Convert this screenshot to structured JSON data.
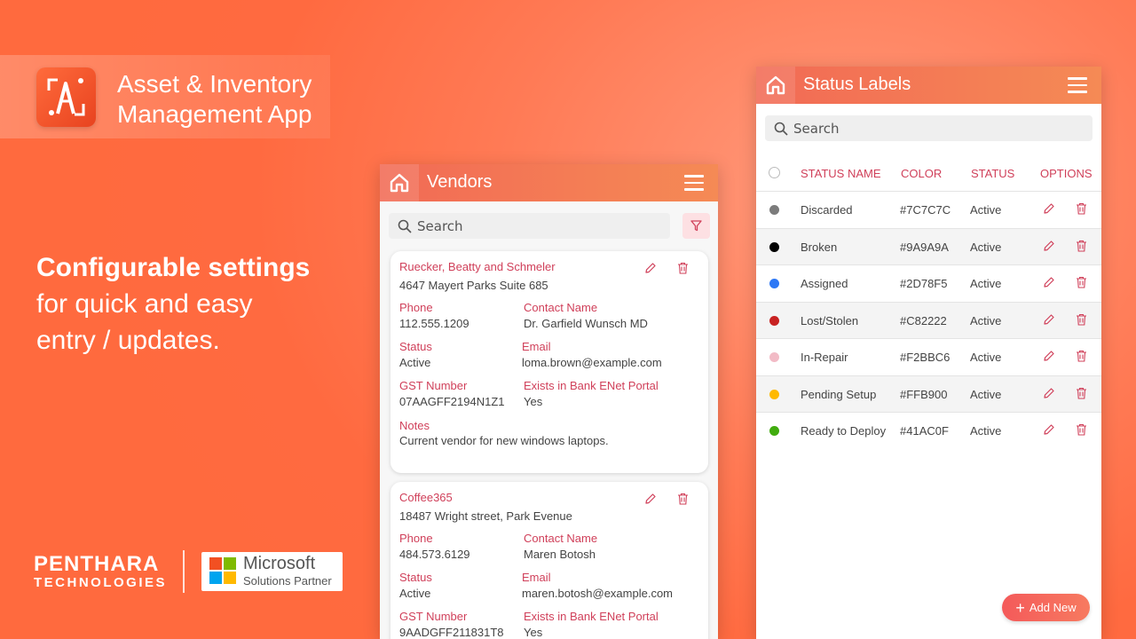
{
  "branding": {
    "app_title_line1": "Asset & Inventory",
    "app_title_line2": "Management App",
    "headline_bold": "Configurable settings",
    "headline_line2": "for quick and easy",
    "headline_line3": "entry / updates.",
    "company_line1": "PENTHARA",
    "company_line2": "TECHNOLOGIES",
    "partner_line1": "Microsoft",
    "partner_line2": "Solutions Partner"
  },
  "colors": {
    "accent": "#f26a55",
    "label": "#d0405a"
  },
  "vendors_panel": {
    "title": "Vendors",
    "search_placeholder": "Search",
    "cards": [
      {
        "name": "Ruecker, Beatty and Schmeler",
        "address": "4647 Mayert Parks Suite 685",
        "phone_label": "Phone",
        "phone": "112.555.1209",
        "contact_label": "Contact Name",
        "contact": "Dr. Garfield Wunsch MD",
        "status_label": "Status",
        "status": "Active",
        "email_label": "Email",
        "email": "loma.brown@example.com",
        "gst_label": "GST Number",
        "gst": "07AAGFF2194N1Z1",
        "portal_label": "Exists in Bank ENet Portal",
        "portal": "Yes",
        "notes_label": "Notes",
        "notes": "Current vendor for new windows laptops."
      },
      {
        "name": "Coffee365",
        "address": "18487 Wright street, Park Evenue",
        "phone_label": "Phone",
        "phone": "484.573.6129",
        "contact_label": "Contact Name",
        "contact": "Maren Botosh",
        "status_label": "Status",
        "status": "Active",
        "email_label": "Email",
        "email": "maren.botosh@example.com",
        "gst_label": "GST Number",
        "gst": "9AADGFF211831T8",
        "portal_label": "Exists in Bank ENet Portal",
        "portal": "Yes"
      }
    ]
  },
  "status_panel": {
    "title": "Status Labels",
    "search_placeholder": "Search",
    "columns": [
      "STATUS NAME",
      "COLOR",
      "STATUS",
      "OPTIONS"
    ],
    "rows": [
      {
        "name": "Discarded",
        "color": "#7C7C7C",
        "status": "Active"
      },
      {
        "name": "Broken",
        "color": "#9A9A9A",
        "status": "Active"
      },
      {
        "name": "Assigned",
        "color": "#2D78F5",
        "status": "Active"
      },
      {
        "name": "Lost/Stolen",
        "color": "#C82222",
        "status": "Active"
      },
      {
        "name": "In-Repair",
        "color": "#F2BBC6",
        "status": "Active"
      },
      {
        "name": "Pending Setup",
        "color": "#FFB900",
        "status": "Active"
      },
      {
        "name": "Ready to Deploy",
        "color": "#41AC0F",
        "status": "Active"
      }
    ],
    "dot_colors": [
      "#7c7c7c",
      "#000000",
      "#2d78f5",
      "#c82222",
      "#f2bbc6",
      "#ffb900",
      "#41ac0f"
    ],
    "add_button": "Add New"
  }
}
